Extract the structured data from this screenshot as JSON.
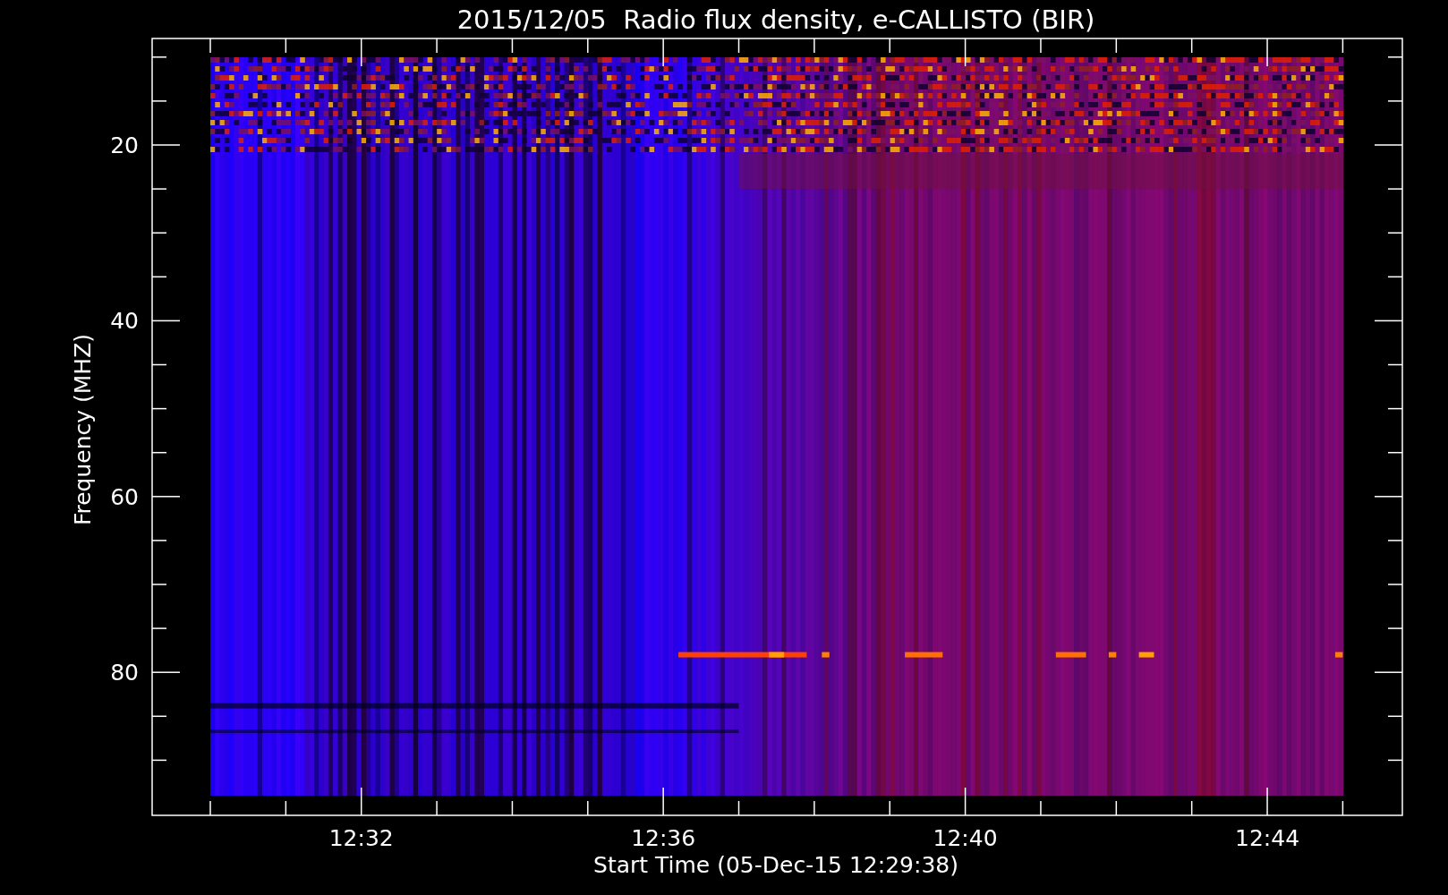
{
  "plot": {
    "title": "2015/12/05  Radio flux density, e-CALLISTO (BIR)",
    "ylabel": "Frequency (MHZ)",
    "xlabel": "Start Time (05-Dec-15 12:29:38)",
    "yticks": [
      "20",
      "40",
      "60",
      "80"
    ],
    "xticks": [
      "12:32",
      "12:36",
      "12:40",
      "12:44"
    ]
  }
}
